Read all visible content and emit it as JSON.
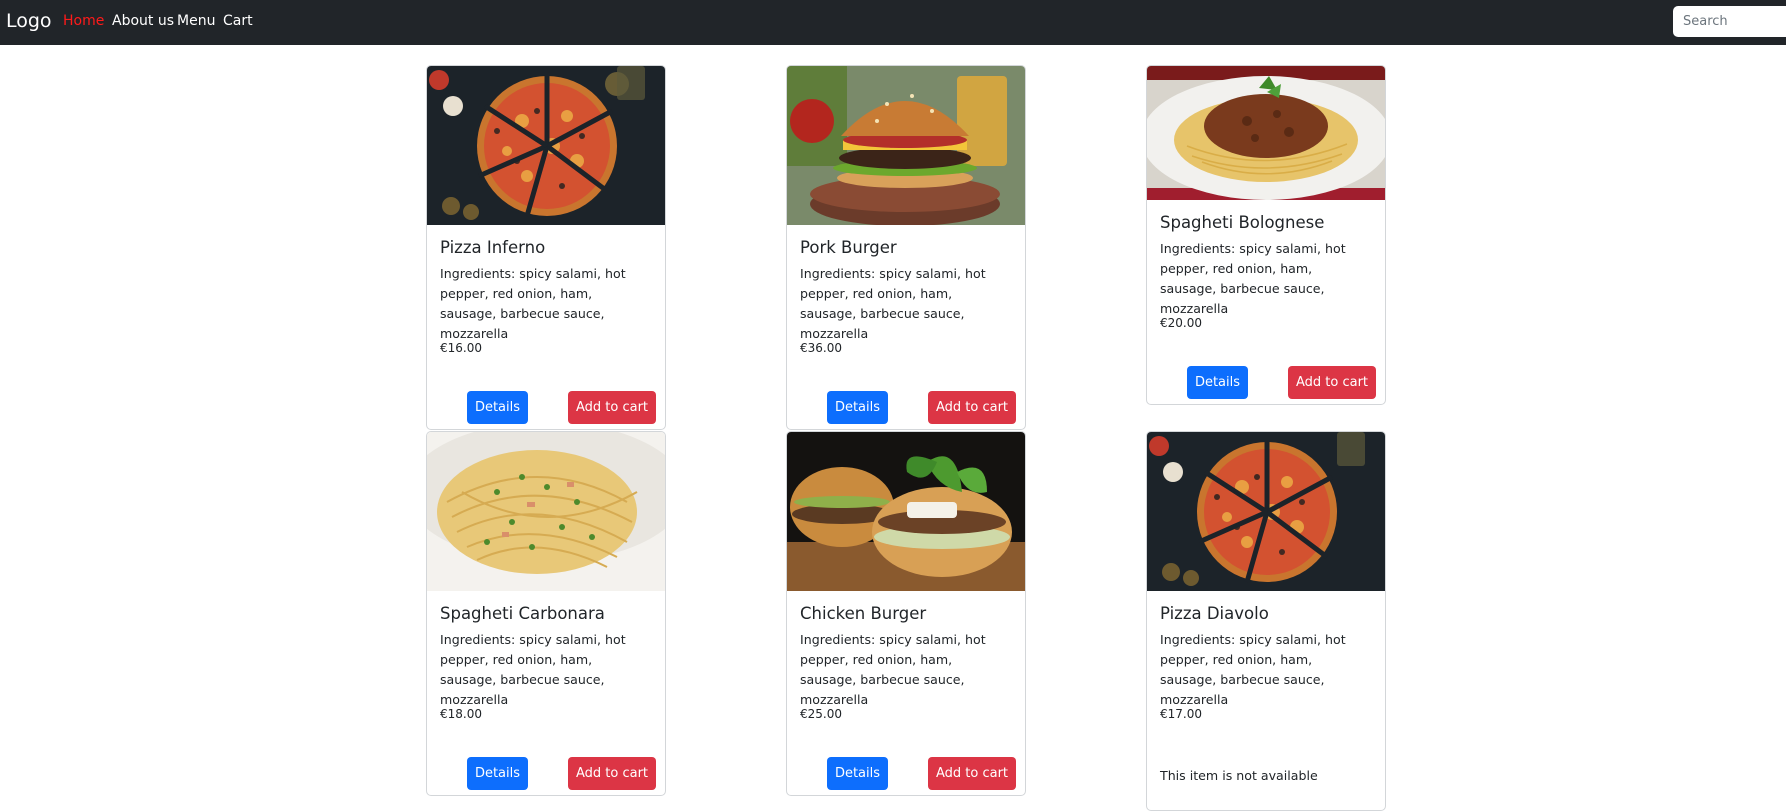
{
  "nav": {
    "brand": "Logo",
    "links": [
      "Home",
      "About us",
      "Menu",
      "Cart"
    ],
    "search_placeholder": "Search"
  },
  "cards": [
    {
      "title": "Pizza Inferno",
      "ingredients": "Ingredients: spicy salami, hot pepper, red onion, ham, sausage, barbecue sauce, mozzarella",
      "price": "€16.00",
      "details_label": "Details",
      "cart_label": "Add to cart",
      "image": "pizza-photo"
    },
    {
      "title": "Pork Burger",
      "ingredients": "Ingredients: spicy salami, hot pepper, red onion, ham, sausage, barbecue sauce, mozzarella",
      "price": "€36.00",
      "details_label": "Details",
      "cart_label": "Add to cart",
      "image": "burger-photo"
    },
    {
      "title": "Spagheti Bolognese",
      "ingredients": "Ingredients: spicy salami, hot pepper, red onion, ham, sausage, barbecue sauce, mozzarella",
      "price": "€20.00",
      "details_label": "Details",
      "cart_label": "Add to cart",
      "image": "bolognese-photo"
    },
    {
      "title": "Spagheti Carbonara",
      "ingredients": "Ingredients: spicy salami, hot pepper, red onion, ham, sausage, barbecue sauce, mozzarella",
      "price": "€18.00",
      "details_label": "Details",
      "cart_label": "Add to cart",
      "image": "carbonara-photo"
    },
    {
      "title": "Chicken Burger",
      "ingredients": "Ingredients: spicy salami, hot pepper, red onion, ham, sausage, barbecue sauce, mozzarella",
      "price": "€25.00",
      "details_label": "Details",
      "cart_label": "Add to cart",
      "image": "chicken-burger-photo"
    },
    {
      "title": "Pizza Diavolo",
      "ingredients": "Ingredients: spicy salami, hot pepper, red onion, ham, sausage, barbecue sauce, mozzarella",
      "price": "€17.00",
      "unavailable_text": "This item is not available",
      "image": "pizza-photo"
    }
  ],
  "colors": {
    "navbar": "#212529",
    "active_link": "#ff1a1a",
    "details_button": "#0d6efd",
    "cart_button": "#dc3545"
  }
}
